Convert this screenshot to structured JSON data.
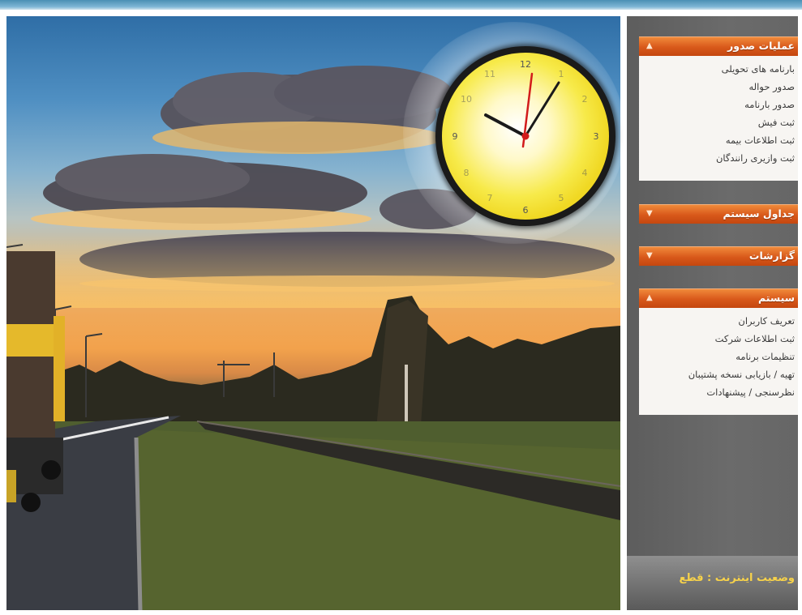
{
  "clock": {
    "numerals": [
      "12",
      "1",
      "2",
      "3",
      "4",
      "5",
      "6",
      "7",
      "8",
      "9",
      "10",
      "11"
    ]
  },
  "sidebar": {
    "panels": [
      {
        "title": "عملیات صدور",
        "chevron": "up",
        "expanded": true,
        "items": [
          "بارنامه های تحویلی",
          "صدور حواله",
          "صدور بارنامه",
          "ثبت فیش",
          "ثبت اطلاعات بیمه",
          "ثبت وازیری رانندگان"
        ]
      },
      {
        "title": "جداول سیستم",
        "chevron": "down",
        "expanded": false
      },
      {
        "title": "گزارشات",
        "chevron": "down",
        "expanded": false
      },
      {
        "title": "سیستم",
        "chevron": "up",
        "expanded": true,
        "items": [
          "تعریف کاربران",
          "ثبت اطلاعات شرکت",
          "تنظیمات برنامه",
          "تهیه / بازیابی نسخه پشتیبان",
          "نظرسنجی / پیشنهادات"
        ]
      }
    ],
    "status_text": "وضعیت اینترنت :  قطع"
  },
  "colors": {
    "accent_orange": "#d8581a",
    "status_yellow": "#f7d24a",
    "sidebar_gray": "#666666",
    "clock_face": "#f4e63a"
  }
}
